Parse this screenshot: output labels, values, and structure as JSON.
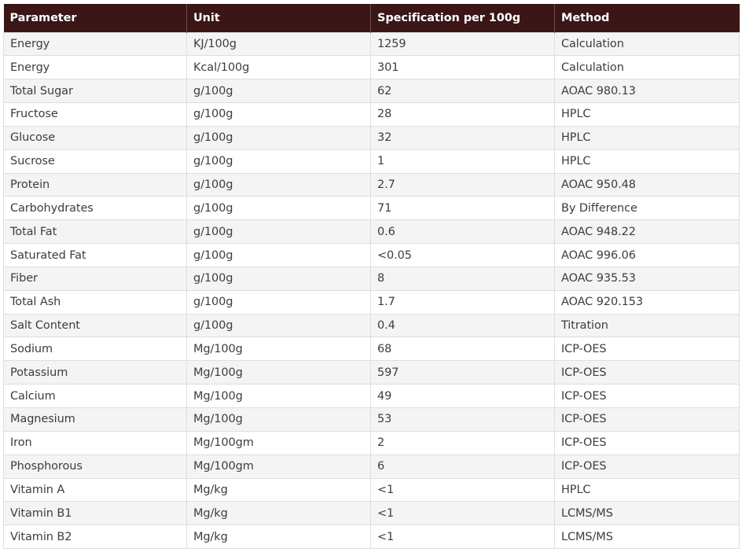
{
  "table": {
    "headers": [
      "Parameter",
      "Unit",
      "Specification per 100g",
      "Method"
    ],
    "rows": [
      [
        "Energy",
        "KJ/100g",
        "1259",
        "Calculation"
      ],
      [
        "Energy",
        "Kcal/100g",
        "301",
        "Calculation"
      ],
      [
        "Total Sugar",
        "g/100g",
        "62",
        "AOAC 980.13"
      ],
      [
        "Fructose",
        "g/100g",
        "28",
        "HPLC"
      ],
      [
        "Glucose",
        "g/100g",
        "32",
        "HPLC"
      ],
      [
        "Sucrose",
        "g/100g",
        "1",
        "HPLC"
      ],
      [
        "Protein",
        "g/100g",
        "2.7",
        "AOAC 950.48"
      ],
      [
        "Carbohydrates",
        "g/100g",
        "71",
        "By Difference"
      ],
      [
        "Total Fat",
        "g/100g",
        "0.6",
        "AOAC 948.22"
      ],
      [
        "Saturated Fat",
        "g/100g",
        "<0.05",
        "AOAC 996.06"
      ],
      [
        "Fiber",
        "g/100g",
        "8",
        "AOAC 935.53"
      ],
      [
        "Total Ash",
        "g/100g",
        "1.7",
        "AOAC 920.153"
      ],
      [
        "Salt Content",
        "g/100g",
        "0.4",
        "Titration"
      ],
      [
        "Sodium",
        "Mg/100g",
        "68",
        "ICP-OES"
      ],
      [
        "Potassium",
        "Mg/100g",
        "597",
        "ICP-OES"
      ],
      [
        "Calcium",
        "Mg/100g",
        "49",
        "ICP-OES"
      ],
      [
        "Magnesium",
        "Mg/100g",
        "53",
        "ICP-OES"
      ],
      [
        "Iron",
        "Mg/100gm",
        "2",
        "ICP-OES"
      ],
      [
        "Phosphorous",
        "Mg/100gm",
        "6",
        "ICP-OES"
      ],
      [
        "Vitamin A",
        "Mg/kg",
        "<1",
        "HPLC"
      ],
      [
        "Vitamin B1",
        "Mg/kg",
        "<1",
        "LCMS/MS"
      ],
      [
        "Vitamin B2",
        "Mg/kg",
        "<1",
        "LCMS/MS"
      ]
    ]
  },
  "colors": {
    "header_bg": "#3a1616",
    "header_text": "#ffffff",
    "row_alt": "#f4f4f4",
    "border": "#dedede",
    "cell_text": "#3d3d3d"
  }
}
